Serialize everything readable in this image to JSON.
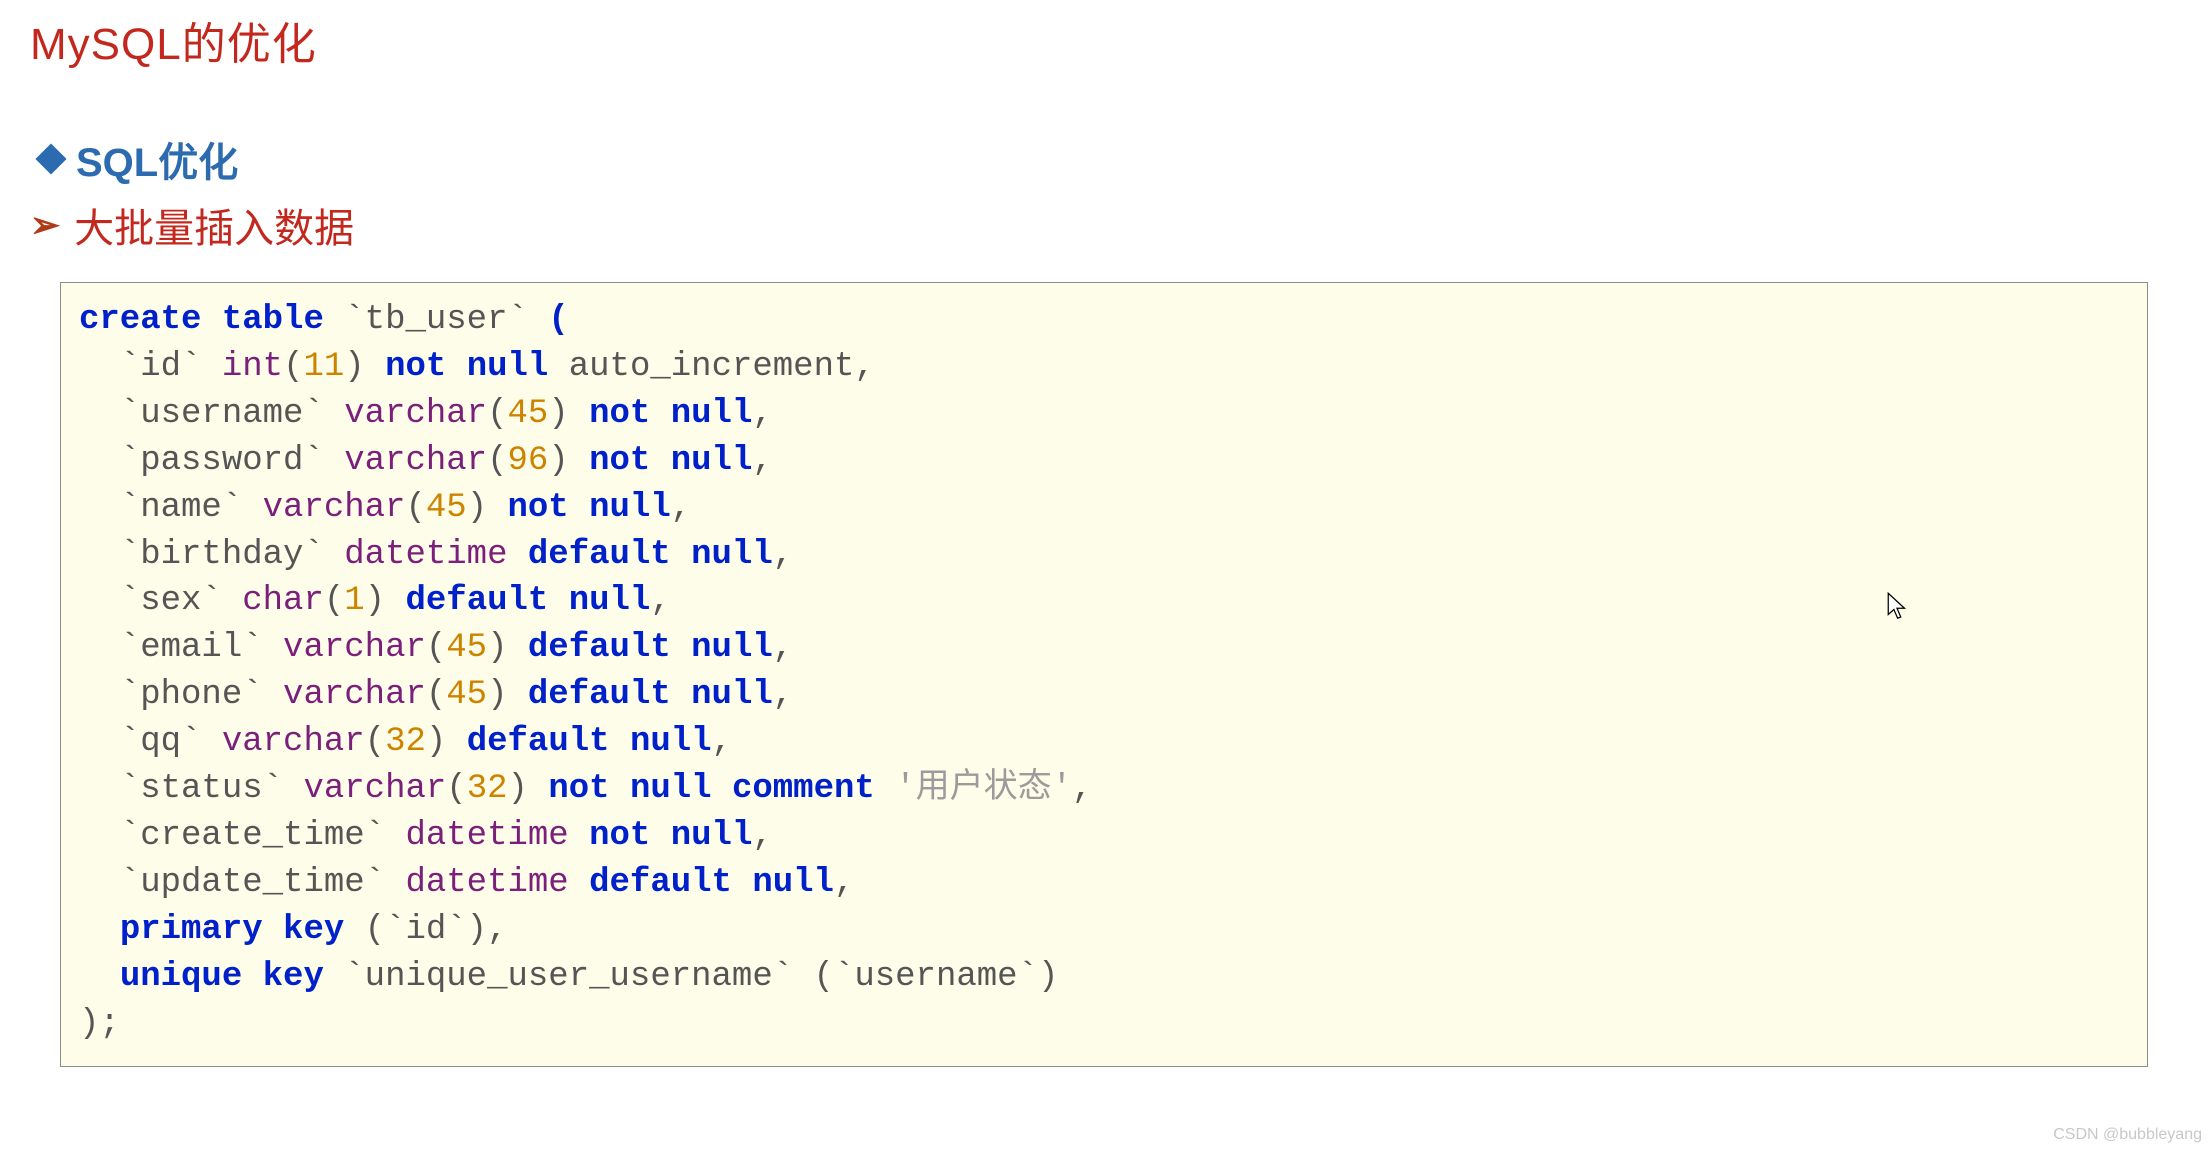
{
  "header": {
    "title": "MySQL的优化",
    "subheading": "SQL优化",
    "section": "大批量插入数据"
  },
  "code": {
    "lines": [
      {
        "indent": 0,
        "tokens": [
          {
            "cls": "kw",
            "t": "create"
          },
          {
            "cls": "id",
            "t": " "
          },
          {
            "cls": "kw",
            "t": "table"
          },
          {
            "cls": "id",
            "t": " `tb_user` "
          },
          {
            "cls": "kw",
            "t": "("
          }
        ]
      },
      {
        "indent": 1,
        "tokens": [
          {
            "cls": "id",
            "t": "`id` "
          },
          {
            "cls": "type",
            "t": "int"
          },
          {
            "cls": "id",
            "t": "("
          },
          {
            "cls": "num",
            "t": "11"
          },
          {
            "cls": "id",
            "t": ") "
          },
          {
            "cls": "kw",
            "t": "not"
          },
          {
            "cls": "id",
            "t": " "
          },
          {
            "cls": "kw",
            "t": "null"
          },
          {
            "cls": "id",
            "t": " auto_increment,"
          }
        ]
      },
      {
        "indent": 1,
        "tokens": [
          {
            "cls": "id",
            "t": "`username` "
          },
          {
            "cls": "type",
            "t": "varchar"
          },
          {
            "cls": "id",
            "t": "("
          },
          {
            "cls": "num",
            "t": "45"
          },
          {
            "cls": "id",
            "t": ") "
          },
          {
            "cls": "kw",
            "t": "not"
          },
          {
            "cls": "id",
            "t": " "
          },
          {
            "cls": "kw",
            "t": "null"
          },
          {
            "cls": "id",
            "t": ","
          }
        ]
      },
      {
        "indent": 1,
        "tokens": [
          {
            "cls": "id",
            "t": "`password` "
          },
          {
            "cls": "type",
            "t": "varchar"
          },
          {
            "cls": "id",
            "t": "("
          },
          {
            "cls": "num",
            "t": "96"
          },
          {
            "cls": "id",
            "t": ") "
          },
          {
            "cls": "kw",
            "t": "not"
          },
          {
            "cls": "id",
            "t": " "
          },
          {
            "cls": "kw",
            "t": "null"
          },
          {
            "cls": "id",
            "t": ","
          }
        ]
      },
      {
        "indent": 1,
        "tokens": [
          {
            "cls": "id",
            "t": "`name` "
          },
          {
            "cls": "type",
            "t": "varchar"
          },
          {
            "cls": "id",
            "t": "("
          },
          {
            "cls": "num",
            "t": "45"
          },
          {
            "cls": "id",
            "t": ") "
          },
          {
            "cls": "kw",
            "t": "not"
          },
          {
            "cls": "id",
            "t": " "
          },
          {
            "cls": "kw",
            "t": "null"
          },
          {
            "cls": "id",
            "t": ","
          }
        ]
      },
      {
        "indent": 1,
        "tokens": [
          {
            "cls": "id",
            "t": "`birthday` "
          },
          {
            "cls": "type",
            "t": "datetime"
          },
          {
            "cls": "id",
            "t": " "
          },
          {
            "cls": "kw",
            "t": "default"
          },
          {
            "cls": "id",
            "t": " "
          },
          {
            "cls": "kw",
            "t": "null"
          },
          {
            "cls": "id",
            "t": ","
          }
        ]
      },
      {
        "indent": 1,
        "tokens": [
          {
            "cls": "id",
            "t": "`sex` "
          },
          {
            "cls": "type",
            "t": "char"
          },
          {
            "cls": "id",
            "t": "("
          },
          {
            "cls": "num",
            "t": "1"
          },
          {
            "cls": "id",
            "t": ") "
          },
          {
            "cls": "kw",
            "t": "default"
          },
          {
            "cls": "id",
            "t": " "
          },
          {
            "cls": "kw",
            "t": "null"
          },
          {
            "cls": "id",
            "t": ","
          }
        ]
      },
      {
        "indent": 1,
        "tokens": [
          {
            "cls": "id",
            "t": "`email` "
          },
          {
            "cls": "type",
            "t": "varchar"
          },
          {
            "cls": "id",
            "t": "("
          },
          {
            "cls": "num",
            "t": "45"
          },
          {
            "cls": "id",
            "t": ") "
          },
          {
            "cls": "kw",
            "t": "default"
          },
          {
            "cls": "id",
            "t": " "
          },
          {
            "cls": "kw",
            "t": "null"
          },
          {
            "cls": "id",
            "t": ","
          }
        ]
      },
      {
        "indent": 1,
        "tokens": [
          {
            "cls": "id",
            "t": "`phone` "
          },
          {
            "cls": "type",
            "t": "varchar"
          },
          {
            "cls": "id",
            "t": "("
          },
          {
            "cls": "num",
            "t": "45"
          },
          {
            "cls": "id",
            "t": ") "
          },
          {
            "cls": "kw",
            "t": "default"
          },
          {
            "cls": "id",
            "t": " "
          },
          {
            "cls": "kw",
            "t": "null"
          },
          {
            "cls": "id",
            "t": ","
          }
        ]
      },
      {
        "indent": 1,
        "tokens": [
          {
            "cls": "id",
            "t": "`qq` "
          },
          {
            "cls": "type",
            "t": "varchar"
          },
          {
            "cls": "id",
            "t": "("
          },
          {
            "cls": "num",
            "t": "32"
          },
          {
            "cls": "id",
            "t": ") "
          },
          {
            "cls": "kw",
            "t": "default"
          },
          {
            "cls": "id",
            "t": " "
          },
          {
            "cls": "kw",
            "t": "null"
          },
          {
            "cls": "id",
            "t": ","
          }
        ]
      },
      {
        "indent": 1,
        "tokens": [
          {
            "cls": "id",
            "t": "`status` "
          },
          {
            "cls": "type",
            "t": "varchar"
          },
          {
            "cls": "id",
            "t": "("
          },
          {
            "cls": "num",
            "t": "32"
          },
          {
            "cls": "id",
            "t": ") "
          },
          {
            "cls": "kw",
            "t": "not"
          },
          {
            "cls": "id",
            "t": " "
          },
          {
            "cls": "kw",
            "t": "null"
          },
          {
            "cls": "id",
            "t": " "
          },
          {
            "cls": "kw",
            "t": "comment"
          },
          {
            "cls": "id",
            "t": " "
          },
          {
            "cls": "str",
            "t": "'用户状态'"
          },
          {
            "cls": "id",
            "t": ","
          }
        ]
      },
      {
        "indent": 1,
        "tokens": [
          {
            "cls": "id",
            "t": "`create_time` "
          },
          {
            "cls": "type",
            "t": "datetime"
          },
          {
            "cls": "id",
            "t": " "
          },
          {
            "cls": "kw",
            "t": "not"
          },
          {
            "cls": "id",
            "t": " "
          },
          {
            "cls": "kw",
            "t": "null"
          },
          {
            "cls": "id",
            "t": ","
          }
        ]
      },
      {
        "indent": 1,
        "tokens": [
          {
            "cls": "id",
            "t": "`update_time` "
          },
          {
            "cls": "type",
            "t": "datetime"
          },
          {
            "cls": "id",
            "t": " "
          },
          {
            "cls": "kw",
            "t": "default"
          },
          {
            "cls": "id",
            "t": " "
          },
          {
            "cls": "kw",
            "t": "null"
          },
          {
            "cls": "id",
            "t": ","
          }
        ]
      },
      {
        "indent": 1,
        "tokens": [
          {
            "cls": "kw",
            "t": "primary"
          },
          {
            "cls": "id",
            "t": " "
          },
          {
            "cls": "kw",
            "t": "key"
          },
          {
            "cls": "id",
            "t": " (`id`),"
          }
        ]
      },
      {
        "indent": 1,
        "tokens": [
          {
            "cls": "kw",
            "t": "unique"
          },
          {
            "cls": "id",
            "t": " "
          },
          {
            "cls": "kw",
            "t": "key"
          },
          {
            "cls": "id",
            "t": " `unique_user_username` (`username`)"
          }
        ]
      },
      {
        "indent": 0,
        "tokens": [
          {
            "cls": "id",
            "t": ");"
          }
        ]
      }
    ],
    "indent_unit": "  "
  },
  "watermark": "CSDN @bubbleyang"
}
